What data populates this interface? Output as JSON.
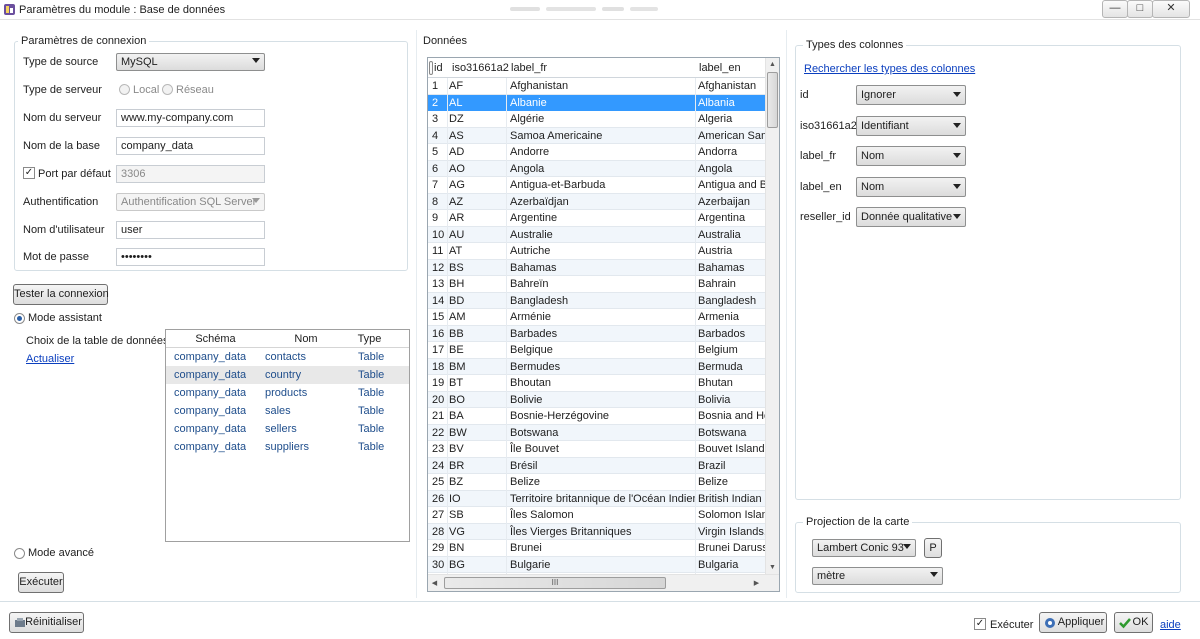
{
  "window": {
    "title": "Paramètres du module : Base de données",
    "minimize": "—",
    "maximize": "□",
    "close": "✕"
  },
  "connection": {
    "legend": "Paramètres de connexion",
    "source_label": "Type de source",
    "source_value": "MySQL",
    "server_type_label": "Type de serveur",
    "local_label": "Local",
    "network_label": "Réseau",
    "server_name_label": "Nom du serveur",
    "server_name_value": "www.my-company.com",
    "db_name_label": "Nom de la base",
    "db_name_value": "company_data",
    "default_port_label": "Port par défaut",
    "default_port_checked": true,
    "port_value": "3306",
    "auth_label": "Authentification",
    "auth_value": "Authentification SQL Server",
    "user_label": "Nom d'utilisateur",
    "user_value": "user",
    "password_label": "Mot de passe",
    "password_value": "••••••••"
  },
  "test_button": "Tester la connexion",
  "assistant": {
    "label": "Mode assistant",
    "table_choice_label": "Choix de la table de données",
    "refresh_link": "Actualiser",
    "columns": [
      "Schéma",
      "Nom",
      "Type"
    ],
    "rows": [
      [
        "company_data",
        "contacts",
        "Table"
      ],
      [
        "company_data",
        "country",
        "Table"
      ],
      [
        "company_data",
        "products",
        "Table"
      ],
      [
        "company_data",
        "sales",
        "Table"
      ],
      [
        "company_data",
        "sellers",
        "Table"
      ],
      [
        "company_data",
        "suppliers",
        "Table"
      ]
    ],
    "selected_row": 1
  },
  "advanced": {
    "label": "Mode avancé",
    "execute_button": "Exécuter"
  },
  "data": {
    "title": "Données",
    "columns": [
      "id",
      "iso31661a2",
      "label_fr",
      "label_en"
    ],
    "selected_row": 1,
    "rows": [
      [
        "1",
        "AF",
        "Afghanistan",
        "Afghanistan"
      ],
      [
        "2",
        "AL",
        "Albanie",
        "Albania"
      ],
      [
        "3",
        "DZ",
        "Algérie",
        "Algeria"
      ],
      [
        "4",
        "AS",
        "Samoa Americaine",
        "American Sam"
      ],
      [
        "5",
        "AD",
        "Andorre",
        "Andorra"
      ],
      [
        "6",
        "AO",
        "Angola",
        "Angola"
      ],
      [
        "7",
        "AG",
        "Antigua-et-Barbuda",
        "Antigua and Ba"
      ],
      [
        "8",
        "AZ",
        "Azerbaïdjan",
        "Azerbaijan"
      ],
      [
        "9",
        "AR",
        "Argentine",
        "Argentina"
      ],
      [
        "10",
        "AU",
        "Australie",
        "Australia"
      ],
      [
        "11",
        "AT",
        "Autriche",
        "Austria"
      ],
      [
        "12",
        "BS",
        "Bahamas",
        "Bahamas"
      ],
      [
        "13",
        "BH",
        "Bahreïn",
        "Bahrain"
      ],
      [
        "14",
        "BD",
        "Bangladesh",
        "Bangladesh"
      ],
      [
        "15",
        "AM",
        "Arménie",
        "Armenia"
      ],
      [
        "16",
        "BB",
        "Barbades",
        "Barbados"
      ],
      [
        "17",
        "BE",
        "Belgique",
        "Belgium"
      ],
      [
        "18",
        "BM",
        "Bermudes",
        "Bermuda"
      ],
      [
        "19",
        "BT",
        "Bhoutan",
        "Bhutan"
      ],
      [
        "20",
        "BO",
        "Bolivie",
        "Bolivia"
      ],
      [
        "21",
        "BA",
        "Bosnie-Herzégovine",
        "Bosnia and He"
      ],
      [
        "22",
        "BW",
        "Botswana",
        "Botswana"
      ],
      [
        "23",
        "BV",
        "Île Bouvet",
        "Bouvet Island"
      ],
      [
        "24",
        "BR",
        "Brésil",
        "Brazil"
      ],
      [
        "25",
        "BZ",
        "Belize",
        "Belize"
      ],
      [
        "26",
        "IO",
        "Territoire britannique de l'Océan Indien",
        "British Indian C"
      ],
      [
        "27",
        "SB",
        "Îles Salomon",
        "Solomon Islan"
      ],
      [
        "28",
        "VG",
        "Îles Vierges Britanniques",
        "Virgin Islands,"
      ],
      [
        "29",
        "BN",
        "Brunei",
        "Brunei Darussa"
      ],
      [
        "30",
        "BG",
        "Bulgarie",
        "Bulgaria"
      ]
    ],
    "hscroll_grip": "III"
  },
  "types": {
    "legend": "Types des colonnes",
    "search_link": "Rechercher les types des colonnes",
    "fields": [
      {
        "name": "id",
        "type": "Ignorer"
      },
      {
        "name": "iso31661a2",
        "type": "Identifiant"
      },
      {
        "name": "label_fr",
        "type": "Nom"
      },
      {
        "name": "label_en",
        "type": "Nom"
      },
      {
        "name": "reseller_id",
        "type": "Donnée qualitative"
      }
    ]
  },
  "projection": {
    "legend": "Projection de la carte",
    "value": "Lambert Conic 93",
    "p_button": "P",
    "unit": "mètre"
  },
  "footer": {
    "reset_button": "Réinitialiser",
    "execute_checkbox_label": "Exécuter",
    "execute_checked": true,
    "apply_button": "Appliquer",
    "ok_button": "OK",
    "help_link": "aide"
  },
  "colors": {
    "selection": "#3399ff",
    "link": "#0b3fbf",
    "alt_row": "#f1f6fb"
  }
}
